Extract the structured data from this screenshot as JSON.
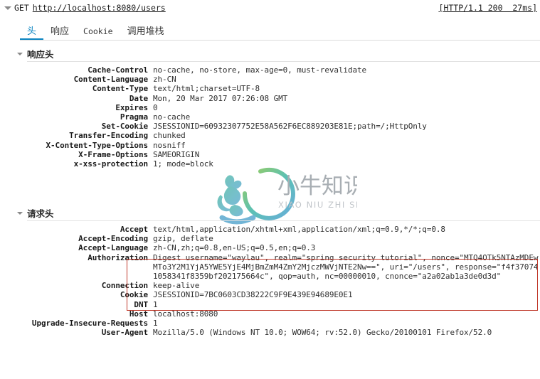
{
  "request_summary": {
    "twisty": "triangle-down-icon",
    "method": "GET",
    "url": "http://localhost:8080/users",
    "status": "[HTTP/1.1 200  27ms]"
  },
  "tabs": [
    {
      "label": "头",
      "active": true,
      "latin": false
    },
    {
      "label": "响应",
      "active": false,
      "latin": false
    },
    {
      "label": "Cookie",
      "active": false,
      "latin": true
    },
    {
      "label": "调用堆栈",
      "active": false,
      "latin": false
    }
  ],
  "response_headers": {
    "title": "响应头",
    "rows": [
      {
        "name": "Cache-Control",
        "value": "no-cache, no-store, max-age=0, must-revalidate"
      },
      {
        "name": "Content-Language",
        "value": "zh-CN"
      },
      {
        "name": "Content-Type",
        "value": "text/html;charset=UTF-8"
      },
      {
        "name": "Date",
        "value": "Mon, 20 Mar 2017 07:26:08 GMT"
      },
      {
        "name": "Expires",
        "value": "0"
      },
      {
        "name": "Pragma",
        "value": "no-cache"
      },
      {
        "name": "Set-Cookie",
        "value": "JSESSIONID=60932307752E58A562F6EC889203E81E;path=/;HttpOnly"
      },
      {
        "name": "Transfer-Encoding",
        "value": "chunked"
      },
      {
        "name": "X-Content-Type-Options",
        "value": "nosniff"
      },
      {
        "name": "X-Frame-Options",
        "value": "SAMEORIGIN"
      },
      {
        "name": "x-xss-protection",
        "value": "1; mode=block"
      }
    ]
  },
  "request_headers": {
    "title": "请求头",
    "rows": [
      {
        "name": "Accept",
        "value": "text/html,application/xhtml+xml,application/xml;q=0.9,*/*;q=0.8"
      },
      {
        "name": "Accept-Encoding",
        "value": "gzip, deflate"
      },
      {
        "name": "Accept-Language",
        "value": "zh-CN,zh;q=0.8,en-US;q=0.5,en;q=0.3"
      },
      {
        "name": "Authorization",
        "value": "Digest username=\"waylau\", realm=\"spring security tutorial\", nonce=\"MTQ4OTk5NTAzMDEwMTo3Y2M1YjA5YWE5YjE4MjBmZmM4ZmY2MjczMWVjNTE2Nw==\", uri=\"/users\", response=\"f4f370741058341f8359bf202175664c\", qop=auth, nc=00000010, cnonce=\"a2a02ab1a3de0d3d\""
      },
      {
        "name": "Connection",
        "value": "keep-alive"
      },
      {
        "name": "Cookie",
        "value": "JSESSIONID=7BC0603CD38222C9F9E439E94689E0E1"
      },
      {
        "name": "DNT",
        "value": "1"
      },
      {
        "name": "Host",
        "value": "localhost:8080"
      },
      {
        "name": "Upgrade-Insecure-Requests",
        "value": "1"
      },
      {
        "name": "User-Agent",
        "value": "Mozilla/5.0 (Windows NT 10.0; WOW64; rv:52.0) Gecko/20100101 Firefox/52.0"
      }
    ]
  },
  "watermark": {
    "chinese": "小牛知识库",
    "pinyin": "XIAO NIU ZHI SHI KU"
  },
  "colors": {
    "accent": "#0a84c1",
    "highlight_border": "#c0392b",
    "watermark_green": "#7fc04a",
    "watermark_blue": "#3d9bd0",
    "watermark_teal": "#2fa3a8"
  }
}
